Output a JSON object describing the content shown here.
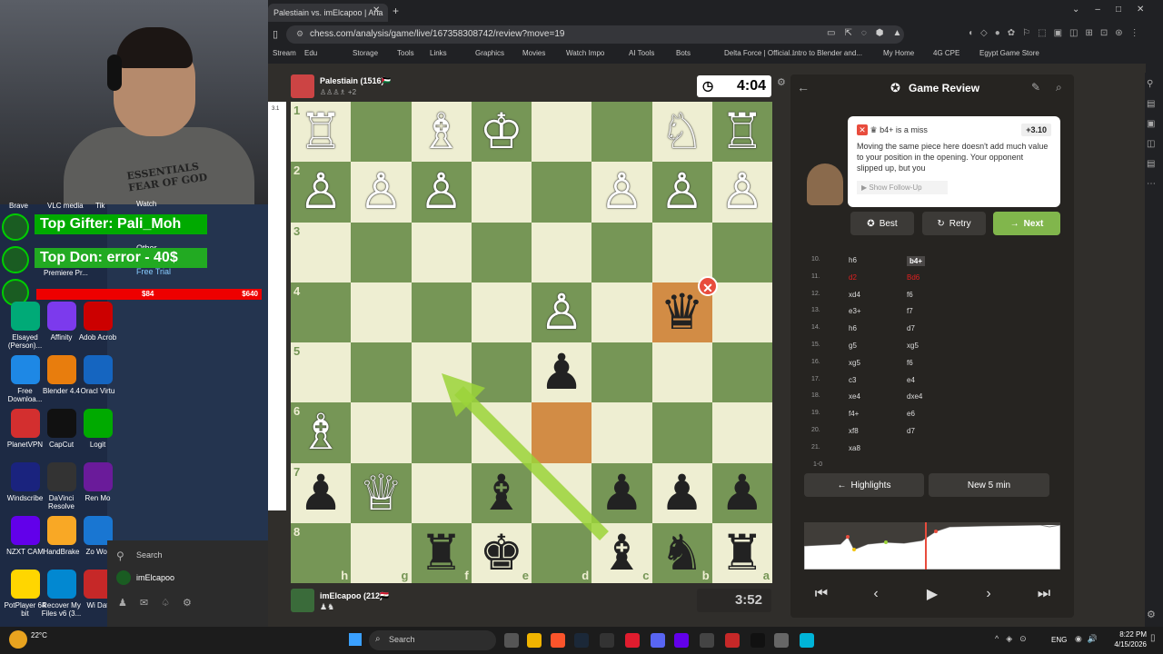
{
  "browser": {
    "tab_title": "Palestiain vs. imElcapoo | Ana",
    "url": "chess.com/analysis/game/live/167358308742/review?move=19",
    "bookmarks": [
      "Stream",
      "Edu",
      "Storage",
      "Tools",
      "Links",
      "Graphics",
      "Movies",
      "Watch Impo",
      "AI Tools",
      "Bots",
      "Delta Force | Official...",
      "Intro to Blender and...",
      "My Home",
      "4G CPE",
      "Egypt Game Store"
    ]
  },
  "stream": {
    "top_gifter": "Top Gifter: Pali_Moh",
    "top_don": "Top Don: error - 40$",
    "goal_current": "$84",
    "goal_target": "$640",
    "hoodie": "ESSENTIALS FEAR OF GOD",
    "overlap_labels": [
      "Brave",
      "VLC media",
      "Tik",
      "Watch",
      "Other",
      "Premiere Pr...",
      "Free Trial"
    ]
  },
  "desktop_icons": [
    {
      "label": "Elsayed (Person)...",
      "color": "#0a7"
    },
    {
      "label": "Affinity",
      "color": "#7c3aed"
    },
    {
      "label": "Adob Acrob",
      "color": "#c00"
    },
    {
      "label": "Free Downloa...",
      "color": "#1e88e5"
    },
    {
      "label": "Blender 4.4",
      "color": "#e87d0d"
    },
    {
      "label": "Oracl Virtu",
      "color": "#1565c0"
    },
    {
      "label": "PlanetVPN",
      "color": "#d32f2f"
    },
    {
      "label": "CapCut",
      "color": "#111"
    },
    {
      "label": "Logit",
      "color": "#0a0"
    },
    {
      "label": "Windscribe",
      "color": "#1a237e"
    },
    {
      "label": "DaVinci Resolve",
      "color": "#333"
    },
    {
      "label": "Ren Mo",
      "color": "#6a1b9a"
    },
    {
      "label": "NZXT CAM",
      "color": "#6200ea"
    },
    {
      "label": "HandBrake",
      "color": "#f9a825"
    },
    {
      "label": "Zo Wor",
      "color": "#1976d2"
    },
    {
      "label": "PotPlayer 64 bit",
      "color": "#ffd600"
    },
    {
      "label": "Recover My Files v6 (3...",
      "color": "#0288d1"
    },
    {
      "label": "Wi Dat",
      "color": "#c62828"
    }
  ],
  "start_menu": {
    "search": "Search",
    "user": "imElcapoo"
  },
  "game": {
    "top_player": "Palestiain (1516)",
    "top_sub": "+2",
    "top_clock": "4:04",
    "bottom_player": "imElcapoo (212)",
    "bottom_clock": "3:52",
    "side_digit": "3.1"
  },
  "review": {
    "title": "Game Review",
    "move": "b4+ is a miss",
    "eval": "+3.10",
    "explanation": "Moving the same piece here doesn't add much value to your position in the opening. Your opponent slipped up, but you",
    "follow_up": "Show Follow-Up",
    "best": "Best",
    "retry": "Retry",
    "next": "Next",
    "result": "1-0",
    "highlights": "Highlights",
    "new_game": "New 5 min"
  },
  "moves": [
    {
      "n": "10.",
      "w": "h6",
      "b": "b4+",
      "wc": "#ddd",
      "bc": "#fff"
    },
    {
      "n": "11.",
      "w": "d2",
      "b": "Bd6",
      "wc": "#e02020",
      "bc": "#e02020"
    },
    {
      "n": "12.",
      "w": "xd4",
      "b": "f6",
      "wc": "#ddd",
      "bc": "#ddd"
    },
    {
      "n": "13.",
      "w": "e3+",
      "b": "f7",
      "wc": "#ddd",
      "bc": "#ddd"
    },
    {
      "n": "14.",
      "w": "h6",
      "b": "d7",
      "wc": "#ddd",
      "bc": "#ddd"
    },
    {
      "n": "15.",
      "w": "g5",
      "b": "xg5",
      "wc": "#ddd",
      "bc": "#ddd"
    },
    {
      "n": "16.",
      "w": "xg5",
      "b": "f6",
      "wc": "#ddd",
      "bc": "#ddd"
    },
    {
      "n": "17.",
      "w": "c3",
      "b": "e4",
      "wc": "#ddd",
      "bc": "#ddd"
    },
    {
      "n": "18.",
      "w": "xe4",
      "b": "dxe4",
      "wc": "#ddd",
      "bc": "#ddd"
    },
    {
      "n": "19.",
      "w": "f4+",
      "b": "e6",
      "wc": "#ddd",
      "bc": "#ddd"
    },
    {
      "n": "20.",
      "w": "xf8",
      "b": "d7",
      "wc": "#ddd",
      "bc": "#ddd"
    },
    {
      "n": "21.",
      "w": "xa8",
      "b": "",
      "wc": "#ddd",
      "bc": "#ddd"
    }
  ],
  "board": {
    "ranks": [
      "1",
      "2",
      "3",
      "4",
      "5",
      "6",
      "7",
      "8"
    ],
    "files": [
      "h",
      "g",
      "f",
      "e",
      "d",
      "c",
      "b",
      "a"
    ],
    "pieces": [
      [
        "♖",
        "",
        "♗",
        "♔",
        "",
        "",
        "♘",
        "♖"
      ],
      [
        "♙",
        "♙",
        "♙",
        "",
        "",
        "♙",
        "♙",
        "♙"
      ],
      [
        "",
        "",
        "",
        "",
        "",
        "",
        "",
        ""
      ],
      [
        "",
        "",
        "",
        "",
        "♙",
        "",
        "♛",
        ""
      ],
      [
        "",
        "",
        "",
        "",
        "♟",
        "",
        "",
        ""
      ],
      [
        "♗",
        "",
        "",
        "",
        "",
        "",
        "",
        ""
      ],
      [
        "♟",
        "♕",
        "",
        "♝",
        "",
        "♟",
        "♟",
        "♟"
      ],
      [
        "",
        "",
        "♜",
        "♚",
        "",
        "♝",
        "♞",
        "♜"
      ]
    ]
  },
  "taskbar": {
    "weather": "22°C",
    "search": "Search",
    "lang": "ENG",
    "time": "8:22 PM",
    "date": "4/15/2026"
  }
}
